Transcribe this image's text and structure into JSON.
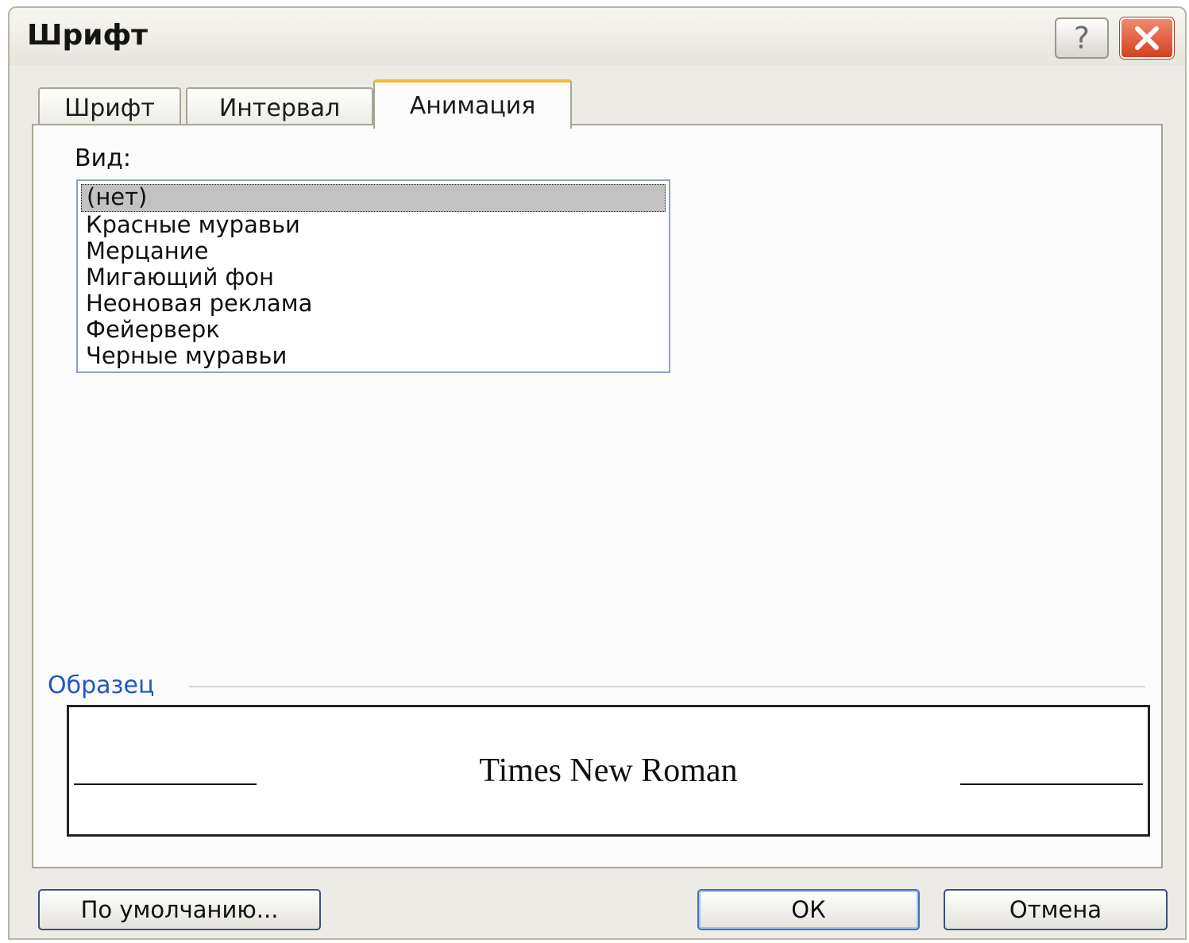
{
  "window": {
    "title": "Шрифт",
    "help_label": "?"
  },
  "tabs": [
    {
      "label": "Шрифт",
      "active": false
    },
    {
      "label": "Интервал",
      "active": false
    },
    {
      "label": "Анимация",
      "active": true
    }
  ],
  "animation": {
    "kind_label": "Вид:",
    "items": [
      {
        "label": "(нет)",
        "selected": true
      },
      {
        "label": "Красные муравьи",
        "selected": false
      },
      {
        "label": "Мерцание",
        "selected": false
      },
      {
        "label": "Мигающий фон",
        "selected": false
      },
      {
        "label": "Неоновая реклама",
        "selected": false
      },
      {
        "label": "Фейерверк",
        "selected": false
      },
      {
        "label": "Черные муравьи",
        "selected": false
      }
    ]
  },
  "sample": {
    "legend": "Образец",
    "text": "Times New Roman"
  },
  "buttons": {
    "default_label": "По умолчанию...",
    "ok_label": "ОК",
    "cancel_label": "Отмена"
  }
}
